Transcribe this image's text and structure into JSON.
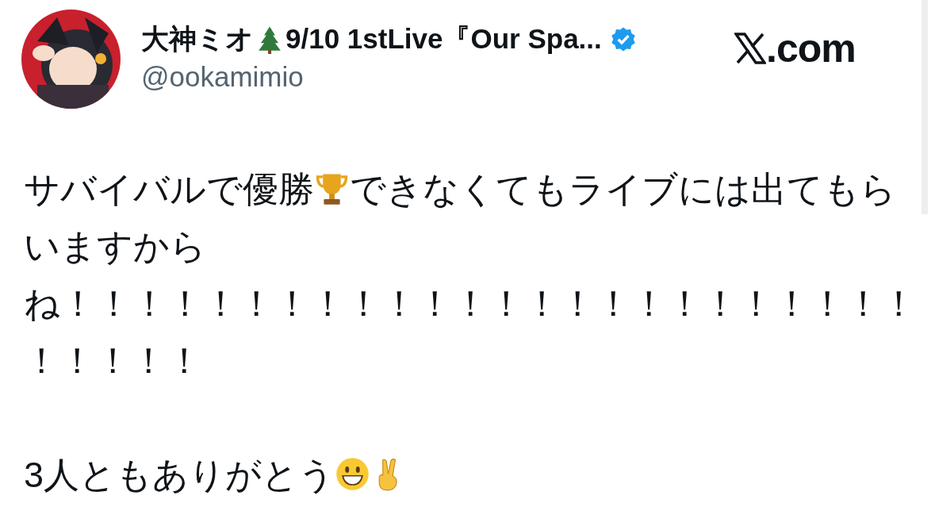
{
  "author": {
    "name": [
      {
        "kind": "text",
        "text": "大神ミオ"
      },
      {
        "kind": "tree"
      },
      {
        "kind": "text",
        "text": "9/10 1stLive『Our Spa..."
      }
    ],
    "verified": true,
    "handle": "@ookamimio"
  },
  "site": {
    "label": ".com"
  },
  "body": [
    [
      [
        {
          "kind": "text",
          "text": "サバイバルで優勝"
        },
        {
          "kind": "trophy"
        },
        {
          "kind": "text",
          "text": "できなくてもライブには出てもら"
        }
      ],
      [
        {
          "kind": "text",
          "text": "いますから"
        }
      ],
      [
        {
          "kind": "text",
          "text": "ね！！！！！！！！！！！！！！！！！！！！！！！！"
        }
      ],
      [
        {
          "kind": "text",
          "text": "！！！！！"
        }
      ]
    ],
    [
      [
        {
          "kind": "text",
          "text": "3人ともありがとう"
        },
        {
          "kind": "grin"
        },
        {
          "kind": "victory"
        }
      ]
    ]
  ]
}
